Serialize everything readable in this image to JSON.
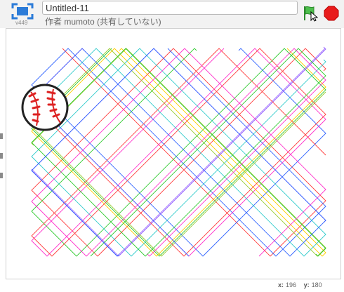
{
  "header": {
    "version": "v449",
    "project_title": "Untitled-11",
    "author_line": "作者 mumoto (共有していない)"
  },
  "controls": {
    "green_flag": "green-flag-icon",
    "stop": "stop-icon"
  },
  "stage": {
    "sprite": "baseball-icon",
    "colors": [
      "#ff4040",
      "#33cc33",
      "#3366ff",
      "#ff33cc",
      "#ffcc00",
      "#33cccc",
      "#9966ff",
      "#99cc33"
    ]
  },
  "status": {
    "x_label": "x:",
    "x_value": "196",
    "y_label": "y:",
    "y_value": "180"
  }
}
